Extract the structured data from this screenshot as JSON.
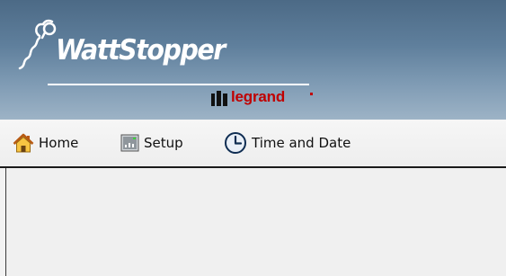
{
  "header": {
    "logo_text": "WattStopper",
    "sub_brand": "legrand",
    "logo_icon": "wattstopper-plug-logo-icon",
    "brand_icon": "legrand-mark-icon",
    "colors": {
      "banner": "#5f7f9c",
      "legrand": "#c00000"
    }
  },
  "nav": {
    "items": [
      {
        "label": "Home",
        "icon": "home-icon"
      },
      {
        "label": "Setup",
        "icon": "setup-icon"
      },
      {
        "label": "Time and Date",
        "icon": "clock-icon"
      }
    ]
  }
}
